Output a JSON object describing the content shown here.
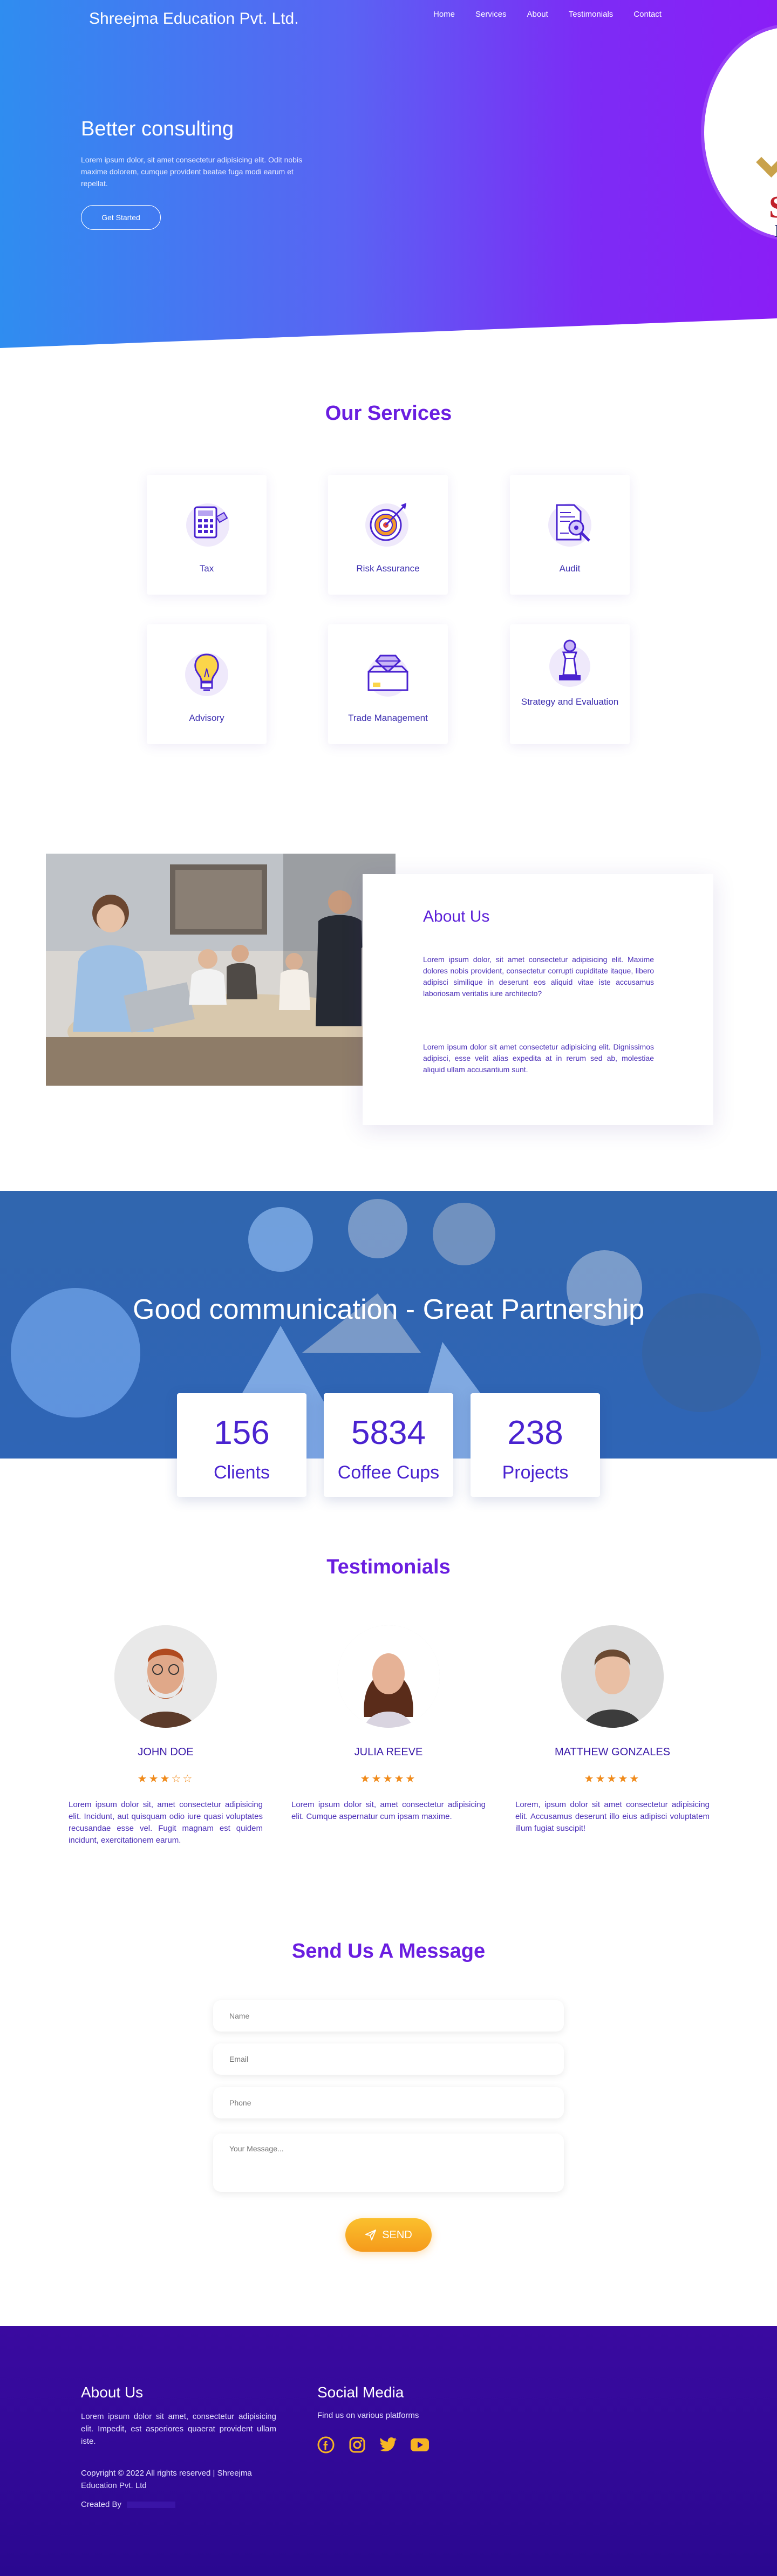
{
  "header": {
    "brand": "Shreejma Education Pvt. Ltd.",
    "nav": [
      "Home",
      "Services",
      "About",
      "Testimonials",
      "Contact"
    ]
  },
  "hero": {
    "title": "Better consulting",
    "text": "Lorem ipsum dolor, sit amet consectetur adipisicing elit. Odit nobis maxime dolorem, cumque provident beatae fuga modi earum et repellat.",
    "button": "Get Started"
  },
  "services": {
    "title": "Our Services",
    "items": [
      {
        "label": "Tax",
        "icon": "calculator-icon"
      },
      {
        "label": "Risk Assurance",
        "icon": "target-icon"
      },
      {
        "label": "Audit",
        "icon": "document-search-icon"
      },
      {
        "label": "Advisory",
        "icon": "lightbulb-icon"
      },
      {
        "label": "Trade Management",
        "icon": "diamond-box-icon"
      },
      {
        "label": "Strategy and Evaluation",
        "icon": "chess-icon"
      }
    ]
  },
  "about": {
    "title": "About Us",
    "p1": "Lorem ipsum dolor, sit amet consectetur adipisicing elit. Maxime dolores nobis provident, consectetur corrupti cupiditate itaque, libero adipisci similique in deserunt eos aliquid vitae iste accusamus laboriosam veritatis iure architecto?",
    "p2": "Lorem ipsum dolor sit amet consectetur adipisicing elit. Dignissimos adipisci, esse velit alias expedita at in rerum sed ab, molestiae aliquid ullam accusantium sunt."
  },
  "partnership": {
    "title": "Good communication - Great Partnership",
    "stats": [
      {
        "value": "156",
        "label": "Clients"
      },
      {
        "value": "5834",
        "label": "Coffee Cups"
      },
      {
        "value": "238",
        "label": "Projects"
      }
    ]
  },
  "testimonials": {
    "title": "Testimonials",
    "items": [
      {
        "name": "JOHN DOE",
        "rating": 3,
        "stars": "★★★☆☆",
        "text": "Lorem ipsum dolor sit, amet consectetur adipisicing elit. Incidunt, aut quisquam odio iure quasi voluptates recusandae esse vel. Fugit magnam est quidem incidunt, exercitationem earum."
      },
      {
        "name": "JULIA REEVE",
        "rating": 5,
        "stars": "★★★★★",
        "text": "Lorem ipsum dolor sit, amet consectetur adipisicing elit. Cumque aspernatur cum ipsam maxime."
      },
      {
        "name": "MATTHEW GONZALES",
        "rating": 5,
        "stars": "★★★★★",
        "text": "Lorem, ipsum dolor sit amet consectetur adipisicing elit. Accusamus deserunt illo eius adipisci voluptatem illum fugiat suscipit!"
      }
    ]
  },
  "contact": {
    "title": "Send Us A Message",
    "name_placeholder": "Name",
    "email_placeholder": "Email",
    "phone_placeholder": "Phone",
    "message_placeholder": "Your Message...",
    "send": "SEND"
  },
  "footer": {
    "about_title": "About Us",
    "about_text": "Lorem ipsum dolor sit amet, consectetur adipisicing elit. Impedit, est asperiores quaerat provident ullam iste.",
    "copyright": "Copyright © 2022 All rights reserved | Shreejma Education Pvt. Ltd",
    "created_by": "Created By",
    "social_title": "Social Media",
    "social_text": "Find us on various platforms",
    "social": [
      "facebook-icon",
      "instagram-icon",
      "twitter-icon",
      "youtube-icon"
    ]
  },
  "colors": {
    "accent": "#6a1ee0",
    "footer": "#2f0896",
    "button": "#f7a823",
    "star": "#f08a1a"
  }
}
